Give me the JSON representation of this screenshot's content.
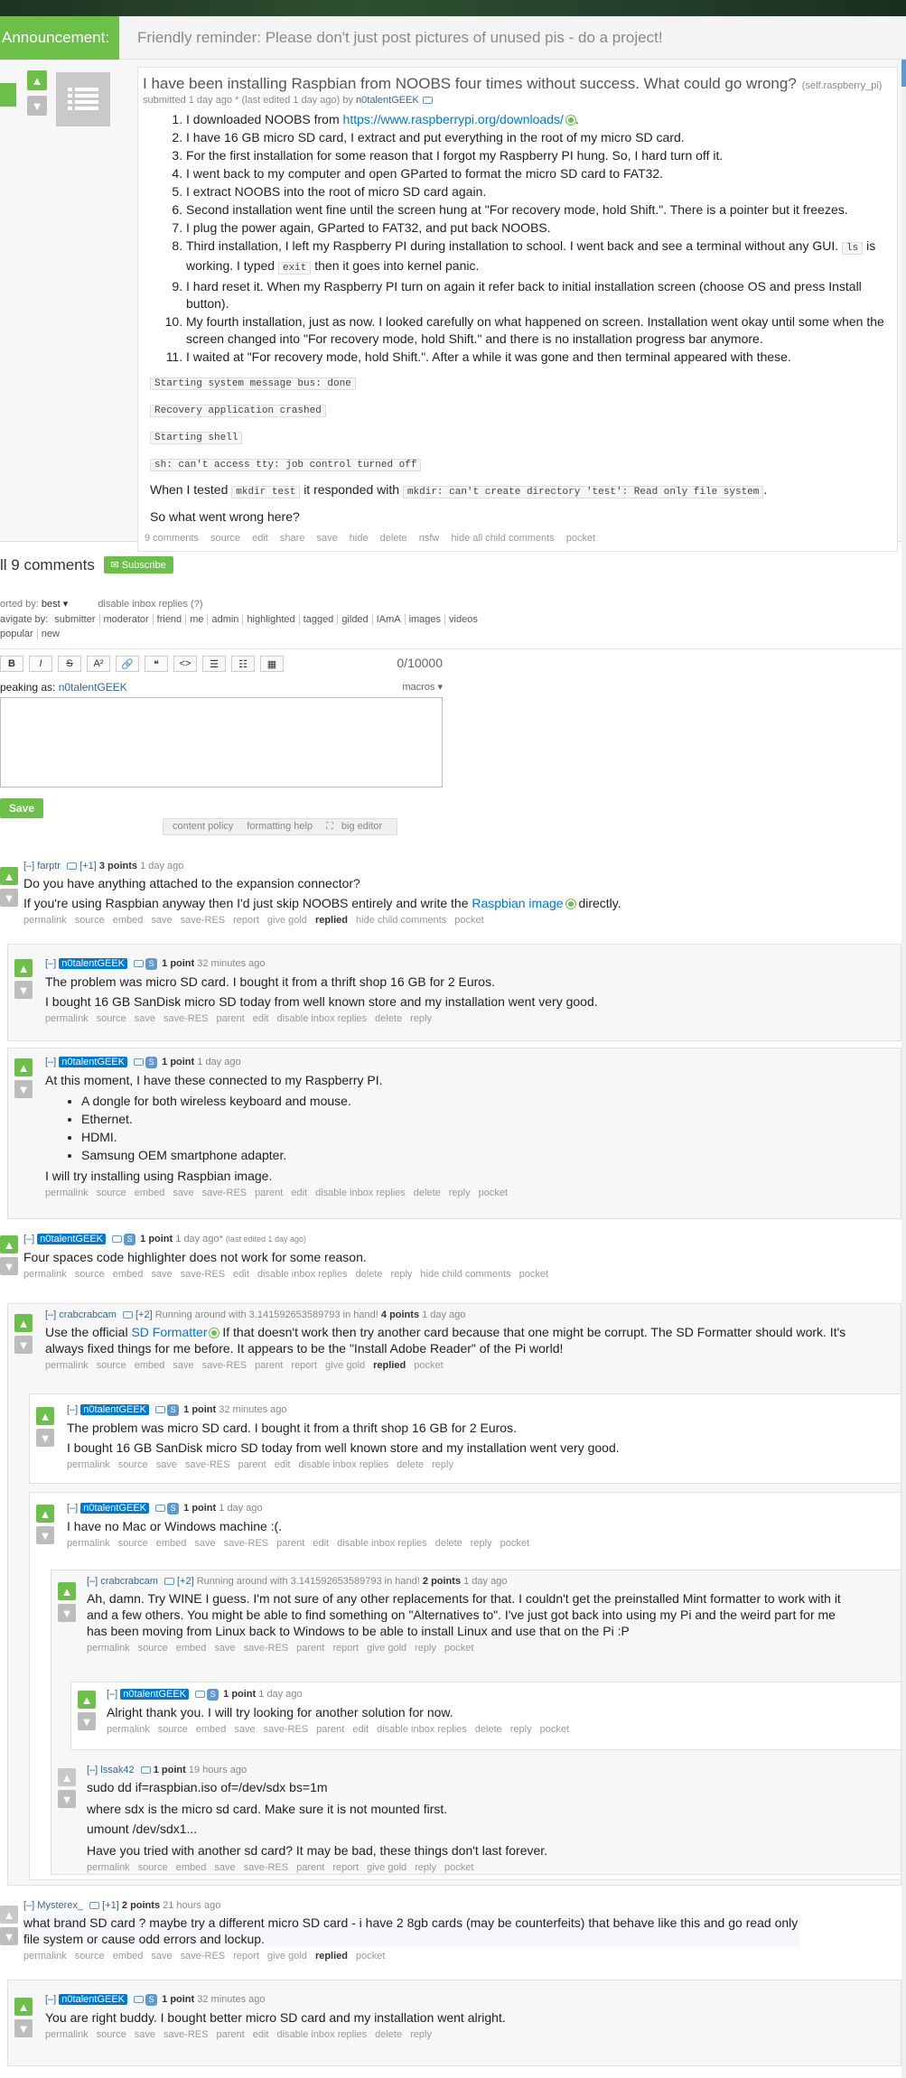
{
  "announcement": {
    "label": "Announcement:",
    "message": "Friendly reminder: Please don't just post pictures of unused pis - do a project!"
  },
  "post": {
    "title": "I have been installing Raspbian from NOOBS four times without success. What could go wrong?",
    "domain": "(self.raspberry_pi)",
    "submitted": "submitted 1 day ago * (last edited 1 day ago) by",
    "author": "n0talentGEEK",
    "items": [
      "I downloaded NOOBS from https://www.raspberrypi.org/downloads/.",
      "I have 16 GB micro SD card, I extract and put everything in the root of my micro SD card.",
      "For the first installation for some reason that I forgot my Raspberry PI hung. So, I hard turn off it.",
      "I went back to my computer and open GParted to format the micro SD card to FAT32.",
      "I extract NOOBS into the root of micro SD card again.",
      "Second installation went fine until the screen hung at \"For recovery mode, hold Shift.\". There is a pointer but it freezes.",
      "I plug the power again, GParted to FAT32, and put back NOOBS.",
      "Third installation, I left my Raspberry PI during installation to school. I went back and see a terminal without any GUI.",
      "I hard reset it. When my Raspberry PI turn on again it refer back to initial installation screen (choose OS and press Install button).",
      "My fourth installation, just as now. I looked carefully on what happened on screen. Installation went okay until some when the screen changed into \"For recovery mode, hold Shift.\" and there is no installation progress bar anymore.",
      "I waited at \"For recovery mode, hold Shift.\". After a while it was gone and then terminal appeared with these."
    ],
    "item1_prefix": "I downloaded NOOBS from",
    "item1_link": "https://www.raspberrypi.org/downloads/",
    "item8_a": "Third installation, I left my Raspberry PI during installation to school. I went back and see a terminal without any GUI.",
    "item8_ls": "ls",
    "item8_b": "is working. I typed",
    "item8_exit": "exit",
    "item8_c": "then it goes into kernel panic.",
    "codes": [
      "Starting system message bus: done",
      "Recovery application crashed",
      "Starting shell",
      "sh: can't access tty: job control turned off"
    ],
    "tested_a": "When I tested",
    "tested_code1": "mkdir test",
    "tested_b": "it responded with",
    "tested_code2": "mkdir: can't create directory 'test': Read only file system",
    "question": "So what went wrong here?",
    "buttons": [
      "9 comments",
      "source",
      "edit",
      "share",
      "save",
      "hide",
      "delete",
      "nsfw",
      "hide all child comments",
      "pocket"
    ]
  },
  "comments_area": {
    "title": "ll 9 comments",
    "subscribe": "Subscribe",
    "sorted_label": "orted by:",
    "sorted_value": "best ▾",
    "disable_inbox": "disable inbox replies (?)",
    "navigate_label": "avigate by:",
    "nav_items": [
      "submitter",
      "moderator",
      "friend",
      "me",
      "admin",
      "highlighted",
      "tagged",
      "gilded",
      "IAmA",
      "images",
      "videos"
    ],
    "nav_items2": [
      "popular",
      "new"
    ],
    "toolbar": [
      "B",
      "I",
      "S",
      "A²",
      "🔗",
      "❝",
      "<>",
      "☰",
      "☷",
      "▦"
    ],
    "counter": "0/10000",
    "speaking_as": "peaking as:",
    "speaking_user": "n0talentGEEK",
    "macros": "macros ▾",
    "save": "Save",
    "editor_buttons": [
      "content policy",
      "formatting help",
      "big editor"
    ]
  },
  "comments": [
    {
      "toggle": "[–]",
      "user": "farptr",
      "tag": "[+1]",
      "points": "3 points",
      "time": "1 day ago",
      "text1": "Do you have anything attached to the expansion connector?",
      "text2a": "If you're using Raspbian anyway then I'd just skip NOOBS entirely and write the",
      "text2link": "Raspbian image",
      "text2b": "directly.",
      "buttons": [
        "permalink",
        "source",
        "embed",
        "save",
        "save-RES",
        "report",
        "give gold",
        "replied",
        "hide child comments",
        "pocket"
      ]
    },
    {
      "toggle": "[–]",
      "user": "n0talentGEEK",
      "points": "1 point",
      "time": "32 minutes ago",
      "text1": "The problem was micro SD card. I bought it from a thrift shop 16 GB for 2 Euros.",
      "text2": "I bought 16 GB SanDisk micro SD today from well known store and my installation went very good.",
      "buttons": [
        "permalink",
        "source",
        "save",
        "save-RES",
        "parent",
        "edit",
        "disable inbox replies",
        "delete",
        "reply"
      ]
    },
    {
      "toggle": "[–]",
      "user": "n0talentGEEK",
      "points": "1 point",
      "time": "1 day ago",
      "text1": "At this moment, I have these connected to my Raspberry PI.",
      "bullets": [
        "A dongle for both wireless keyboard and mouse.",
        "Ethernet.",
        "HDMI.",
        "Samsung OEM smartphone adapter."
      ],
      "text2": "I will try installing using Raspbian image.",
      "buttons": [
        "permalink",
        "source",
        "embed",
        "save",
        "save-RES",
        "parent",
        "edit",
        "disable inbox replies",
        "delete",
        "reply",
        "pocket"
      ]
    },
    {
      "toggle": "[–]",
      "user": "n0talentGEEK",
      "points": "1 point",
      "time": "1 day ago*",
      "edited": "(last edited 1 day ago)",
      "text1": "Four spaces code highlighter does not work for some reason.",
      "buttons": [
        "permalink",
        "source",
        "embed",
        "save",
        "save-RES",
        "edit",
        "disable inbox replies",
        "delete",
        "reply",
        "hide child comments",
        "pocket"
      ]
    },
    {
      "toggle": "[–]",
      "user": "crabcrabcam",
      "tag": "[+2]",
      "flair": "Running around with 3.141592653589793 in hand!",
      "points": "4 points",
      "time": "1 day ago",
      "text1a": "Use the official",
      "text1link": "SD Formatter",
      "text1b": "If that doesn't work then try another card because that one might be corrupt. The SD Formatter should work. It's always fixed things for me before. It appears to be the \"Install Adobe Reader\" of the Pi world!",
      "buttons": [
        "permalink",
        "source",
        "embed",
        "save",
        "save-RES",
        "parent",
        "report",
        "give gold",
        "replied",
        "pocket"
      ]
    },
    {
      "toggle": "[–]",
      "user": "n0talentGEEK",
      "points": "1 point",
      "time": "32 minutes ago",
      "text1": "The problem was micro SD card. I bought it from a thrift shop 16 GB for 2 Euros.",
      "text2": "I bought 16 GB SanDisk micro SD today from well known store and my installation went very good.",
      "buttons": [
        "permalink",
        "source",
        "save",
        "save-RES",
        "parent",
        "edit",
        "disable inbox replies",
        "delete",
        "reply"
      ]
    },
    {
      "toggle": "[–]",
      "user": "n0talentGEEK",
      "points": "1 point",
      "time": "1 day ago",
      "text1": "I have no Mac or Windows machine :(.",
      "buttons": [
        "permalink",
        "source",
        "embed",
        "save",
        "save-RES",
        "parent",
        "edit",
        "disable inbox replies",
        "delete",
        "reply",
        "pocket"
      ]
    },
    {
      "toggle": "[–]",
      "user": "crabcrabcam",
      "tag": "[+2]",
      "flair": "Running around with 3.141592653589793 in hand!",
      "points": "2 points",
      "time": "1 day ago",
      "text1": "Ah, damn. Try WINE I guess. I'm not sure of any other replacements for that. I couldn't get the preinstalled Mint formatter to work with it and a few others. You might be able to find something on \"Alternatives to\". I've just got back into using my Pi and the weird part for me has been moving from Linux back to Windows to be able to install Linux and use that on the Pi :P",
      "buttons": [
        "permalink",
        "source",
        "embed",
        "save",
        "save-RES",
        "parent",
        "report",
        "give gold",
        "reply",
        "pocket"
      ]
    },
    {
      "toggle": "[–]",
      "user": "n0talentGEEK",
      "points": "1 point",
      "time": "1 day ago",
      "text1": "Alright thank you. I will try looking for another solution for now.",
      "buttons": [
        "permalink",
        "source",
        "embed",
        "save",
        "save-RES",
        "parent",
        "edit",
        "disable inbox replies",
        "delete",
        "reply",
        "pocket"
      ]
    },
    {
      "toggle": "[–]",
      "user": "lssak42",
      "points": "1 point",
      "time": "19 hours ago",
      "lines": [
        "sudo dd if=raspbian.iso of=/dev/sdx bs=1m",
        "where sdx is the micro sd card. Make sure it is not mounted first.",
        "umount /dev/sdx1...",
        "Have you tried with another sd card? It may be bad, these things don't last forever."
      ],
      "buttons": [
        "permalink",
        "source",
        "embed",
        "save",
        "save-RES",
        "parent",
        "report",
        "give gold",
        "reply",
        "pocket"
      ]
    },
    {
      "toggle": "[–]",
      "user": "Mysterex_",
      "tag": "[+1]",
      "points": "2 points",
      "time": "21 hours ago",
      "text1": "what brand SD card ? maybe try a different micro SD card - i have 2 8gb cards (may be counterfeits) that behave like this and go read only file system or cause odd errors and lockup.",
      "buttons": [
        "permalink",
        "source",
        "embed",
        "save",
        "save-RES",
        "report",
        "give gold",
        "replied",
        "pocket"
      ]
    },
    {
      "toggle": "[–]",
      "user": "n0talentGEEK",
      "points": "1 point",
      "time": "32 minutes ago",
      "text1": "You are right buddy. I bought better micro SD card and my installation went alright.",
      "buttons": [
        "permalink",
        "source",
        "save",
        "save-RES",
        "parent",
        "edit",
        "disable inbox replies",
        "delete",
        "reply"
      ]
    }
  ]
}
